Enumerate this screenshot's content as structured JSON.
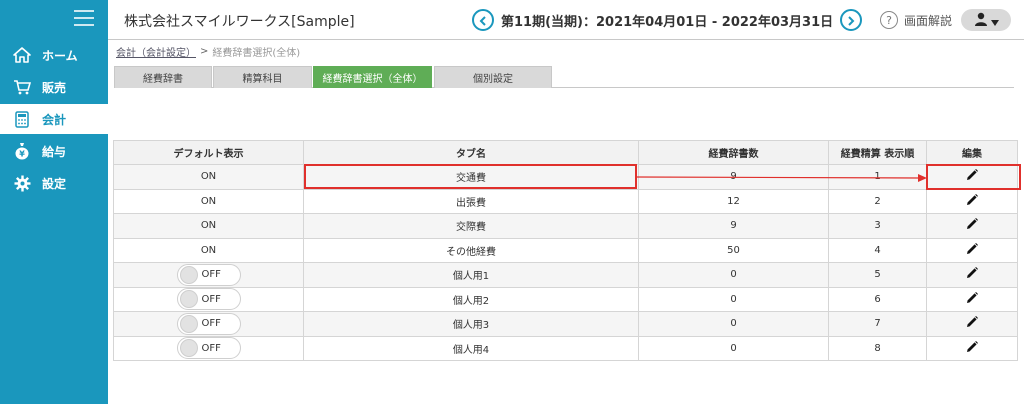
{
  "sidebar": {
    "items": [
      {
        "label": "ホーム",
        "icon": "home-icon"
      },
      {
        "label": "販売",
        "icon": "cart-icon"
      },
      {
        "label": "会計",
        "icon": "calculator-icon"
      },
      {
        "label": "給与",
        "icon": "money-bag-icon"
      },
      {
        "label": "設定",
        "icon": "gear-icon"
      }
    ],
    "active_index": 2
  },
  "header": {
    "company": "株式会社スマイルワークス[Sample]",
    "period": "第11期(当期)：2021年04月01日 - 2022年03月31日",
    "help_label": "画面解説",
    "help_glyph": "?"
  },
  "breadcrumb": {
    "link": "会計（会計設定）",
    "separator": ">",
    "current": "経費辞書選択(全体)"
  },
  "tabs": [
    {
      "label": "経費辞書"
    },
    {
      "label": "精算科目"
    },
    {
      "label": "経費辞書選択（全体）"
    },
    {
      "label": "個別設定"
    }
  ],
  "table": {
    "headers": [
      "デフォルト表示",
      "タブ名",
      "経費辞書数",
      "経費精算 表示順",
      "編集"
    ],
    "rows": [
      {
        "default": "ON",
        "toggle": false,
        "name": "交通費",
        "count": "9",
        "order": "1"
      },
      {
        "default": "ON",
        "toggle": false,
        "name": "出張費",
        "count": "12",
        "order": "2"
      },
      {
        "default": "ON",
        "toggle": false,
        "name": "交際費",
        "count": "9",
        "order": "3"
      },
      {
        "default": "ON",
        "toggle": false,
        "name": "その他経費",
        "count": "50",
        "order": "4"
      },
      {
        "default": "OFF",
        "toggle": true,
        "name": "個人用1",
        "count": "0",
        "order": "5"
      },
      {
        "default": "OFF",
        "toggle": true,
        "name": "個人用2",
        "count": "0",
        "order": "6"
      },
      {
        "default": "OFF",
        "toggle": true,
        "name": "個人用3",
        "count": "0",
        "order": "7"
      },
      {
        "default": "OFF",
        "toggle": true,
        "name": "個人用4",
        "count": "0",
        "order": "8"
      }
    ]
  },
  "colors": {
    "sidebar": "#1a97bd",
    "active_tab": "#5fad56",
    "highlight": "#e0302c"
  }
}
